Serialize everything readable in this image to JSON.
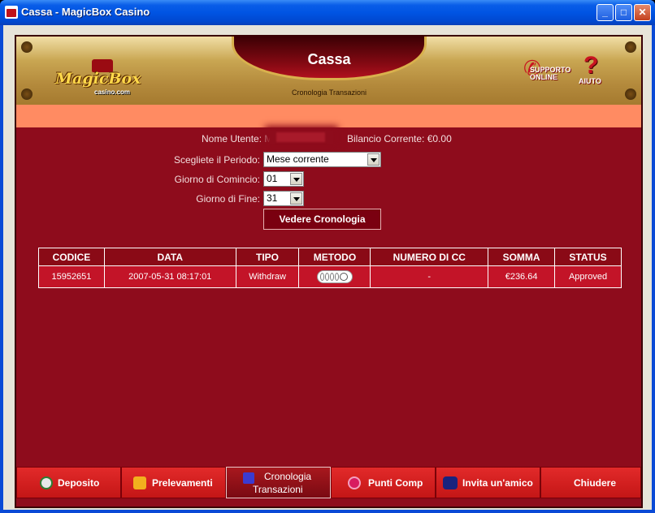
{
  "window": {
    "title": "Cassa - MagicBox Casino",
    "minimize": "_",
    "maximize": "□",
    "close": "✕"
  },
  "header": {
    "logo_text": "MagicBox",
    "logo_sub": "casino.com",
    "title": "Cassa",
    "subtitle": "Cronologia Transazioni",
    "support_label": "SUPPORTO ONLINE",
    "help_label": "AIUTO"
  },
  "account": {
    "username_label": "Nome Utente: M",
    "balance_label": "Bilancio Corrente: €0.00"
  },
  "form": {
    "period_label": "Scegliete il Periodo:",
    "period_value": "Mese corrente",
    "start_label": "Giorno di Comincio:",
    "start_value": "01",
    "end_label": "Giorno di Fine:",
    "end_value": "31",
    "view_button": "Vedere Cronologia"
  },
  "table": {
    "headers": [
      "CODICE",
      "DATA",
      "TIPO",
      "METODO",
      "NUMERO DI CC",
      "SOMMA",
      "STATUS"
    ],
    "rows": [
      {
        "code": "15952651",
        "date": "2007-05-31 08:17:01",
        "type": "Withdraw",
        "method": "card-icon",
        "cc": "-",
        "amount": "€236.64",
        "status": "Approved"
      }
    ]
  },
  "tabs": [
    {
      "label": "Deposito",
      "icon": "deposit-icon",
      "color": "#2e7d32"
    },
    {
      "label": "Prelevamenti",
      "icon": "withdraw-icon",
      "color": "#f2b01e"
    },
    {
      "label": "Cronologia Transazioni",
      "line1": "Cronologia",
      "line2": "Transazioni",
      "icon": "history-icon",
      "active": true,
      "color": "#3b3bd0"
    },
    {
      "label": "Punti Comp",
      "icon": "comp-points-icon",
      "color": "#d81b60"
    },
    {
      "label": "Invita un'amico",
      "icon": "invite-friend-icon",
      "color": "#1a237e"
    },
    {
      "label": "Chiudere"
    }
  ],
  "colors": {
    "background": "#8e0c1c",
    "accent": "#ff8b62",
    "tab": "#d41e1e",
    "gold": "#c9a652"
  }
}
